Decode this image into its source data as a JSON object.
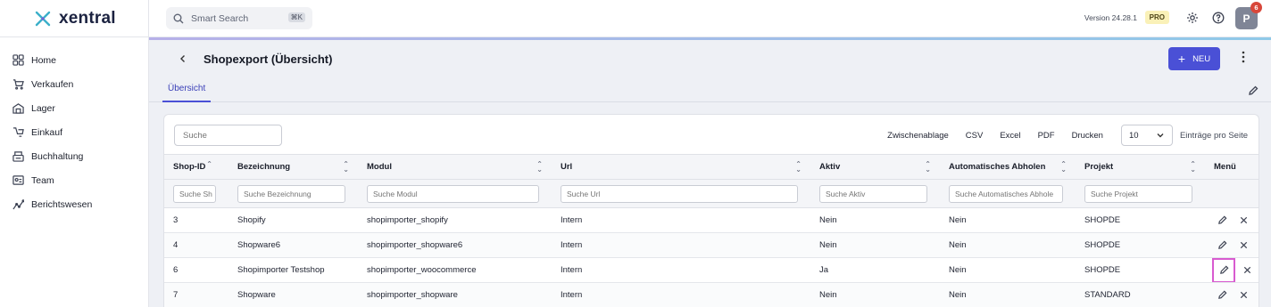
{
  "app": {
    "brand": "xentral"
  },
  "sidebar": {
    "items": [
      {
        "label": "Home",
        "icon": "grid-icon"
      },
      {
        "label": "Verkaufen",
        "icon": "cart-icon"
      },
      {
        "label": "Lager",
        "icon": "warehouse-icon"
      },
      {
        "label": "Einkauf",
        "icon": "purchase-icon"
      },
      {
        "label": "Buchhaltung",
        "icon": "register-icon"
      },
      {
        "label": "Team",
        "icon": "id-card-icon"
      },
      {
        "label": "Berichtswesen",
        "icon": "chart-icon"
      }
    ]
  },
  "header": {
    "search_placeholder": "Smart Search",
    "shortcut": "⌘K",
    "version": "Version 24.28.1",
    "plan": "PRO",
    "avatar_initial": "P",
    "notification_count": "6"
  },
  "page": {
    "title": "Shopexport (Übersicht)",
    "new_button": "NEU",
    "tab": "Übersicht"
  },
  "toolbar": {
    "search_placeholder": "Suche",
    "clipboard": "Zwischenablage",
    "csv": "CSV",
    "excel": "Excel",
    "pdf": "PDF",
    "print": "Drucken",
    "page_size": "10",
    "page_size_label": "Einträge pro Seite"
  },
  "table": {
    "columns": [
      "Shop-ID",
      "Bezeichnung",
      "Modul",
      "Url",
      "Aktiv",
      "Automatisches Abholen",
      "Projekt",
      "Menü"
    ],
    "filters": [
      "Suche Sh",
      "Suche Bezeichnung",
      "Suche Modul",
      "Suche Url",
      "Suche Aktiv",
      "Suche Automatisches Abhole",
      "Suche Projekt"
    ],
    "rows": [
      {
        "id": "3",
        "name": "Shopify",
        "module": "shopimporter_shopify",
        "url": "Intern",
        "active": "Nein",
        "auto": "Nein",
        "project": "SHOPDE"
      },
      {
        "id": "4",
        "name": "Shopware6",
        "module": "shopimporter_shopware6",
        "url": "Intern",
        "active": "Nein",
        "auto": "Nein",
        "project": "SHOPDE"
      },
      {
        "id": "6",
        "name": "Shopimporter Testshop",
        "module": "shopimporter_woocommerce",
        "url": "Intern",
        "active": "Ja",
        "auto": "Nein",
        "project": "SHOPDE"
      },
      {
        "id": "7",
        "name": "Shopware",
        "module": "shopimporter_shopware",
        "url": "Intern",
        "active": "Nein",
        "auto": "Nein",
        "project": "STANDARD"
      }
    ]
  },
  "colors": {
    "accent": "#4a50d6",
    "highlight": "#d85bd0"
  }
}
